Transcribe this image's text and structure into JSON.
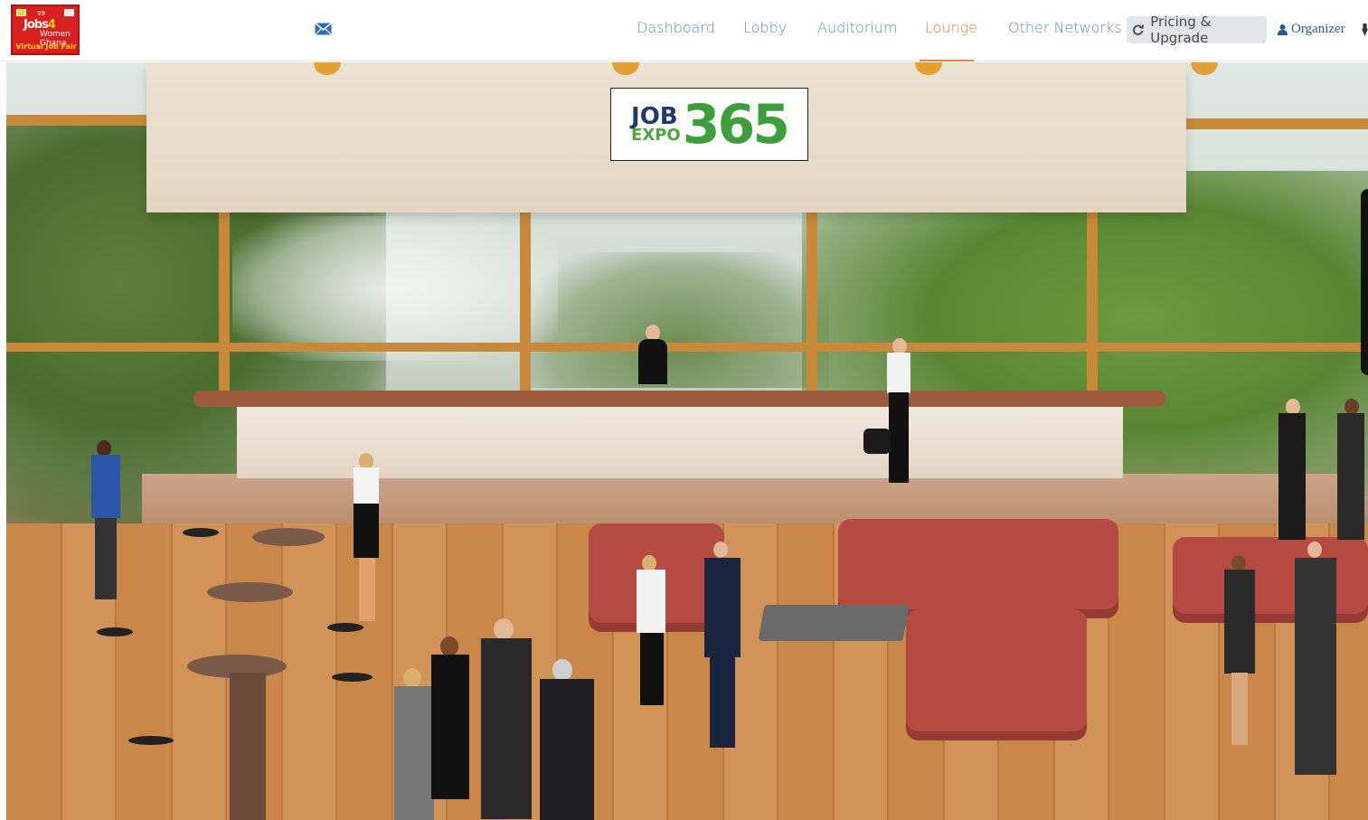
{
  "logo": {
    "number": "99",
    "line1": "Jobs",
    "line1_accent": "4",
    "line2": "Women",
    "line2b": "Ghana",
    "line3": "Virtual Job Fair"
  },
  "nav": {
    "items": [
      {
        "label": "Dashboard",
        "active": false
      },
      {
        "label": "Lobby",
        "active": false
      },
      {
        "label": "Auditorium",
        "active": false
      },
      {
        "label": "Lounge",
        "active": true
      },
      {
        "label": "Other Networks",
        "active": false
      }
    ],
    "pricing_label": "Pricing & Upgrade",
    "organizer_label": "Organizer"
  },
  "banner": {
    "job": "JOB",
    "expo": "EXPO",
    "number": "365"
  },
  "colors": {
    "nav_link": "#5b8fc4",
    "nav_active": "#e8893a",
    "logo_bg": "#d8201e",
    "banner_green": "#3d9e3a",
    "banner_navy": "#22386e"
  },
  "icons": {
    "mail": "envelope-icon",
    "refresh": "refresh-icon",
    "user": "user-icon"
  }
}
